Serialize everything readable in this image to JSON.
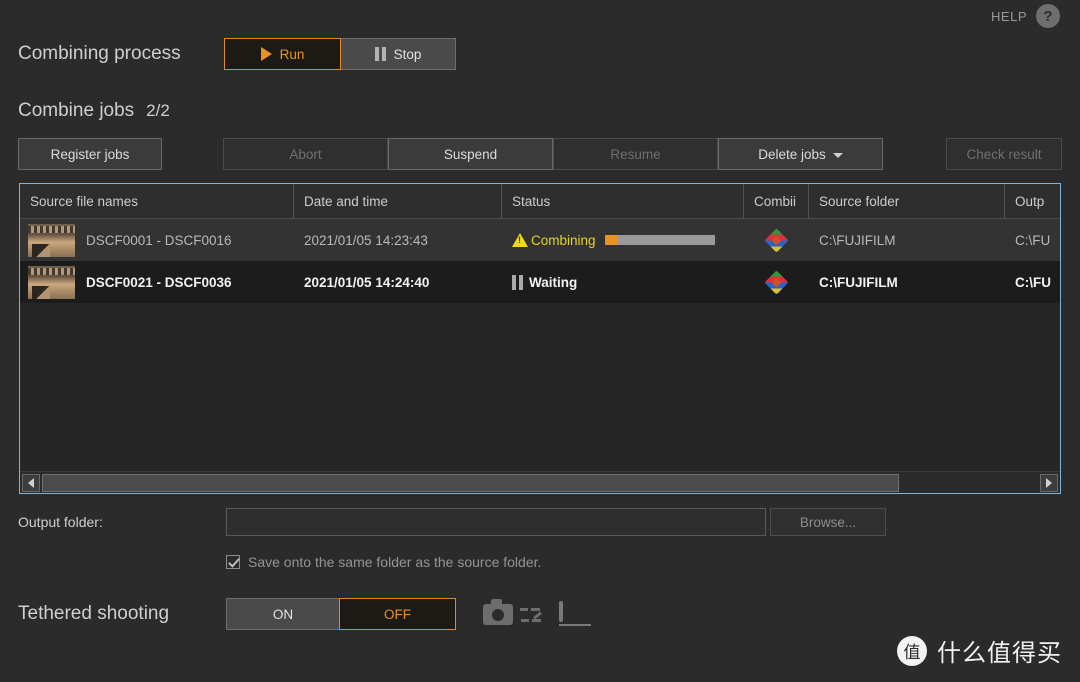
{
  "header": {
    "help_label": "HELP",
    "help_icon": "question-circle-icon"
  },
  "combining_process": {
    "title": "Combining process",
    "run_label": "Run",
    "stop_label": "Stop",
    "selected": "Run"
  },
  "combine_jobs": {
    "title": "Combine jobs",
    "count": "2/2",
    "toolbar": {
      "register_jobs": "Register jobs",
      "abort": "Abort",
      "suspend": "Suspend",
      "resume": "Resume",
      "delete_jobs": "Delete jobs",
      "check_result": "Check result"
    }
  },
  "table": {
    "columns": [
      "Source file names",
      "Date and time",
      "Status",
      "Combii",
      "Source folder",
      "Outp"
    ],
    "rows": [
      {
        "thumbnail": "filmstrip-thumbnail",
        "files": "DSCF0001 - DSCF0016",
        "datetime": "2021/01/05 14:23:43",
        "status": "Combining",
        "status_icon": "warning-triangle-icon",
        "progress_percent": 12,
        "combine_icon": "color-diamond-icon",
        "source_folder": "C:\\FUJIFILM",
        "output_folder": "C:\\FU"
      },
      {
        "thumbnail": "filmstrip-thumbnail",
        "files": "DSCF0021 - DSCF0036",
        "datetime": "2021/01/05 14:24:40",
        "status": "Waiting",
        "status_icon": "pause-icon",
        "progress_percent": null,
        "combine_icon": "color-diamond-icon",
        "source_folder": "C:\\FUJIFILM",
        "output_folder": "C:\\FU"
      }
    ]
  },
  "output_folder": {
    "label": "Output folder:",
    "value": "",
    "placeholder": "",
    "browse_label": "Browse...",
    "checkbox_label": "Save onto the same folder as the source folder.",
    "checkbox_checked": true
  },
  "tethered_shooting": {
    "title": "Tethered shooting",
    "on_label": "ON",
    "off_label": "OFF",
    "selected": "OFF",
    "icons": [
      "camera-icon",
      "connection-dots-icon",
      "monitor-icon"
    ]
  },
  "watermark": {
    "badge": "值",
    "text": "什么值得买"
  },
  "colors": {
    "accent": "#e8921f",
    "warning": "#e8d22a",
    "focus_border": "#7fb4d8",
    "background": "#2b2b2b"
  }
}
